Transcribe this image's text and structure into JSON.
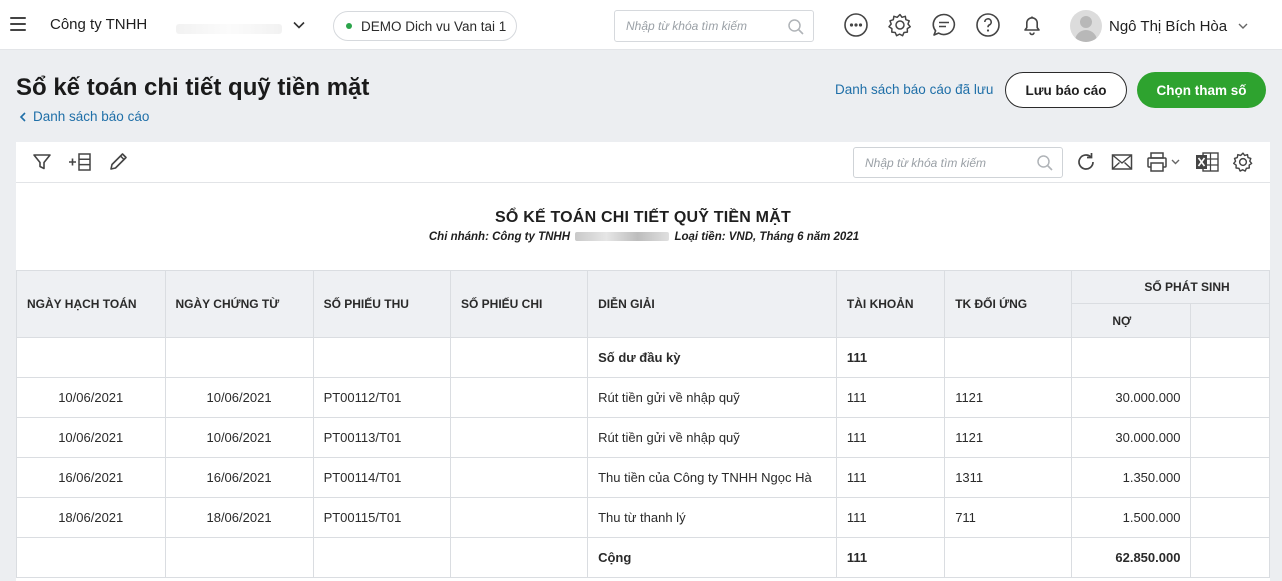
{
  "topbar": {
    "company": "Công ty TNHH",
    "database": "DEMO Dich vu Van tai 1",
    "search_placeholder": "Nhập từ khóa tìm kiếm",
    "user_name": "Ngô Thị Bích Hòa",
    "icons": [
      "more-icon",
      "settings-icon",
      "chat-icon",
      "help-icon",
      "bell-icon"
    ]
  },
  "header": {
    "title": "Sổ kế toán chi tiết quỹ tiền mặt",
    "back_label": "Danh sách báo cáo",
    "saved_reports_label": "Danh sách báo cáo đã lưu",
    "save_button": "Lưu báo cáo",
    "params_button": "Chọn tham số"
  },
  "toolbar": {
    "search_placeholder": "Nhập từ khóa tìm kiếm",
    "icons_left": [
      "filter-icon",
      "add-column-icon",
      "edit-icon"
    ],
    "icons_right": [
      "refresh-icon",
      "email-icon",
      "print-icon",
      "excel-icon",
      "settings-icon"
    ]
  },
  "report": {
    "title": "SỔ KẾ TOÁN CHI TIẾT QUỸ TIỀN MẶT",
    "subtitle_prefix": "Chi nhánh: Công ty TNHH",
    "subtitle_suffix": " Loại tiền: VND, Tháng 6 năm 2021",
    "columns": {
      "posting_date": "NGÀY HẠCH TOÁN",
      "doc_date": "NGÀY CHỨNG TỪ",
      "receipt_no": "SỐ PHIẾU THU",
      "payment_no": "SỐ PHIẾU CHI",
      "description": "DIỄN GIẢI",
      "account": "TÀI KHOẢN",
      "counter_account": "TK ĐỐI ỨNG",
      "amount_group": "SỐ PHÁT SINH",
      "debit": "NỢ"
    },
    "rows": [
      {
        "posting_date": "",
        "doc_date": "",
        "receipt_no": "",
        "payment_no": "",
        "description": "Số dư đầu kỳ",
        "account": "111",
        "counter_account": "",
        "debit": ""
      },
      {
        "posting_date": "10/06/2021",
        "doc_date": "10/06/2021",
        "receipt_no": "PT00112/T01",
        "payment_no": "",
        "description": "Rút tiền gửi về nhập quỹ",
        "account": "111",
        "counter_account": "1121",
        "debit": "30.000.000"
      },
      {
        "posting_date": "10/06/2021",
        "doc_date": "10/06/2021",
        "receipt_no": "PT00113/T01",
        "payment_no": "",
        "description": "Rút tiền gửi về nhập quỹ",
        "account": "111",
        "counter_account": "1121",
        "debit": "30.000.000"
      },
      {
        "posting_date": "16/06/2021",
        "doc_date": "16/06/2021",
        "receipt_no": "PT00114/T01",
        "payment_no": "",
        "description": "Thu tiền của Công ty TNHH Ngọc Hà",
        "account": "111",
        "counter_account": "1311",
        "debit": "1.350.000"
      },
      {
        "posting_date": "18/06/2021",
        "doc_date": "18/06/2021",
        "receipt_no": "PT00115/T01",
        "payment_no": "",
        "description": "Thu từ thanh lý",
        "account": "111",
        "counter_account": "711",
        "debit": "1.500.000"
      },
      {
        "posting_date": "",
        "doc_date": "",
        "receipt_no": "",
        "payment_no": "",
        "description": "Cộng",
        "account": "111",
        "counter_account": "",
        "debit": "62.850.000"
      }
    ]
  }
}
